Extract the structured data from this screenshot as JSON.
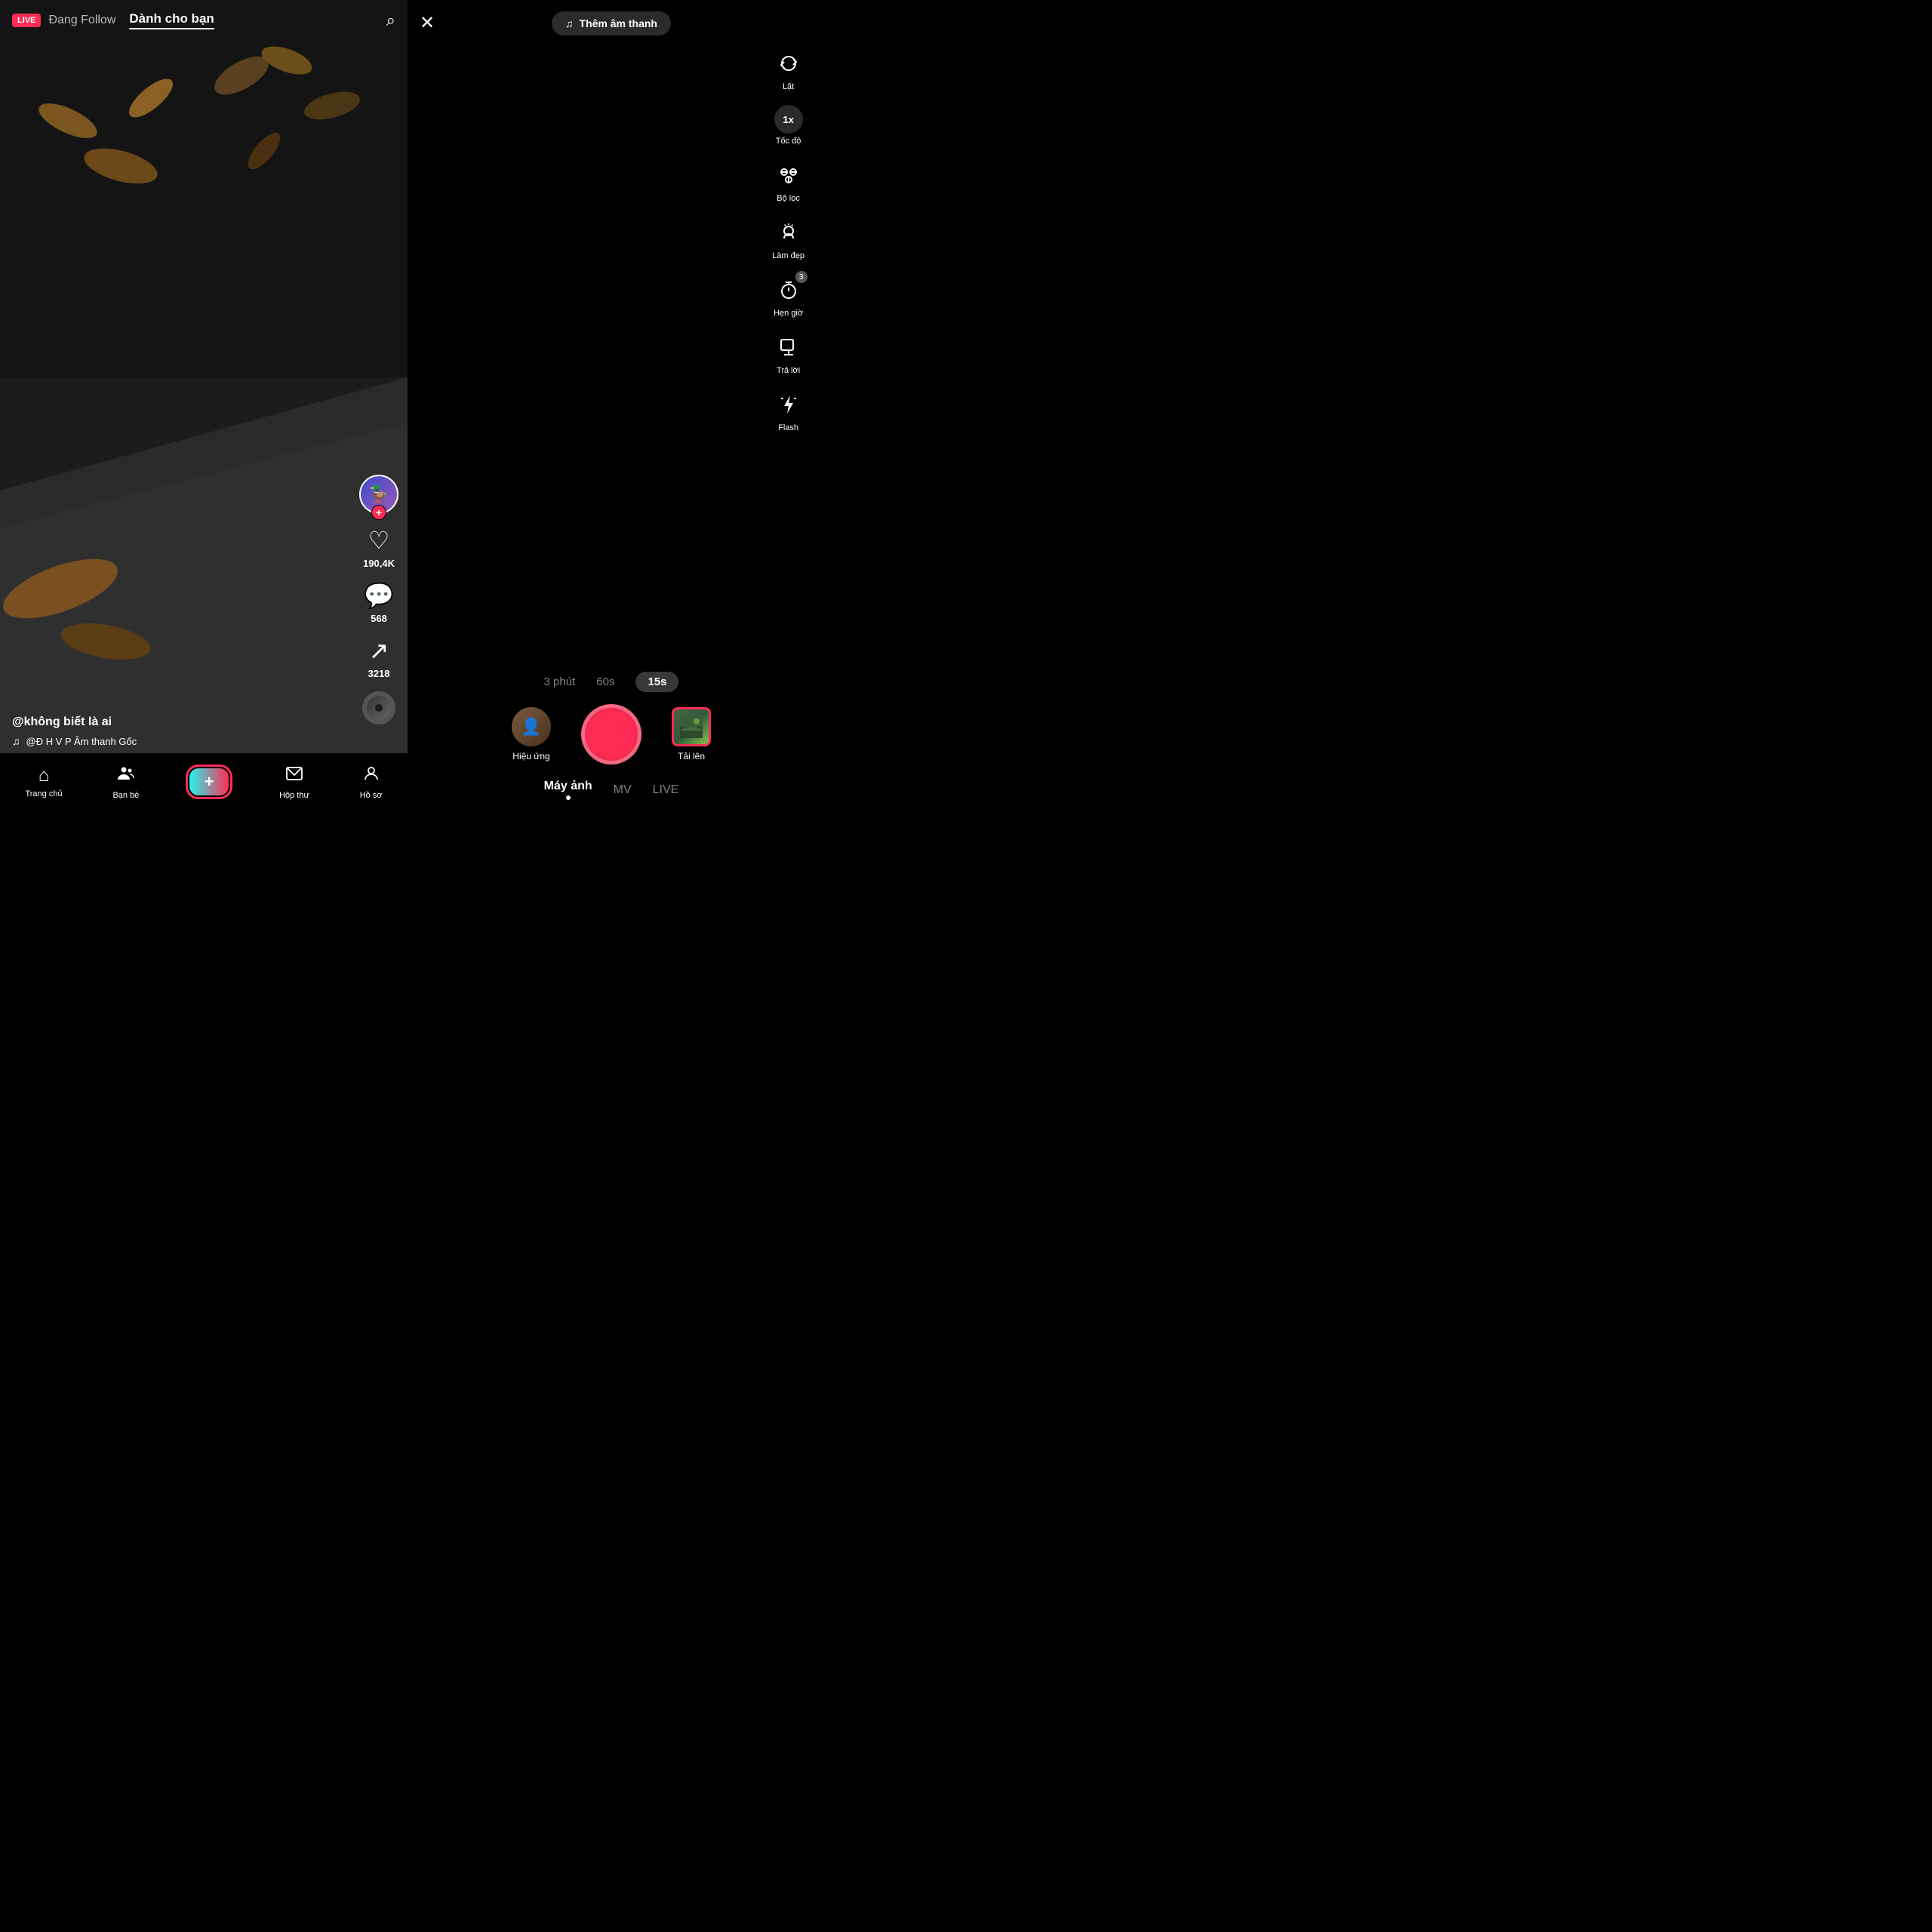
{
  "left": {
    "live_badge": "LIVE",
    "tab_following": "Đang Follow",
    "tab_for_you": "Dành cho bạn",
    "search_icon": "🔍",
    "avatar_emoji": "🦆",
    "like_count": "190,4K",
    "comment_count": "568",
    "share_count": "3218",
    "username": "@không biết là ai",
    "music_note": "♫",
    "music_text": "@Đ H V P Âm thanh Gốc",
    "nav": [
      {
        "label": "Trang chủ",
        "icon": "⌂"
      },
      {
        "label": "Bạn bè",
        "icon": "👥"
      },
      {
        "label": "",
        "icon": "+"
      },
      {
        "label": "Hộp thư",
        "icon": "💬"
      },
      {
        "label": "Hồ sơ",
        "icon": "👤"
      }
    ]
  },
  "right": {
    "close_icon": "✕",
    "add_sound_icon": "♫",
    "add_sound_label": "Thêm âm thanh",
    "flip_label": "Lật",
    "speed_label": "Tốc độ",
    "speed_value": "1x",
    "filter_label": "Bộ lọc",
    "beauty_label": "Làm đẹp",
    "timer_label": "Hẹn giờ",
    "timer_value": "3",
    "reply_label": "Trả lời",
    "flash_label": "Flash",
    "duration_tabs": [
      {
        "label": "3 phút",
        "active": false
      },
      {
        "label": "60s",
        "active": false
      },
      {
        "label": "15s",
        "active": true
      }
    ],
    "effect_label": "Hiệu ứng",
    "upload_label": "Tải lên",
    "mode_tabs": [
      {
        "label": "Máy ảnh",
        "active": true
      },
      {
        "label": "MV",
        "active": false
      },
      {
        "label": "LIVE",
        "active": false
      }
    ]
  }
}
